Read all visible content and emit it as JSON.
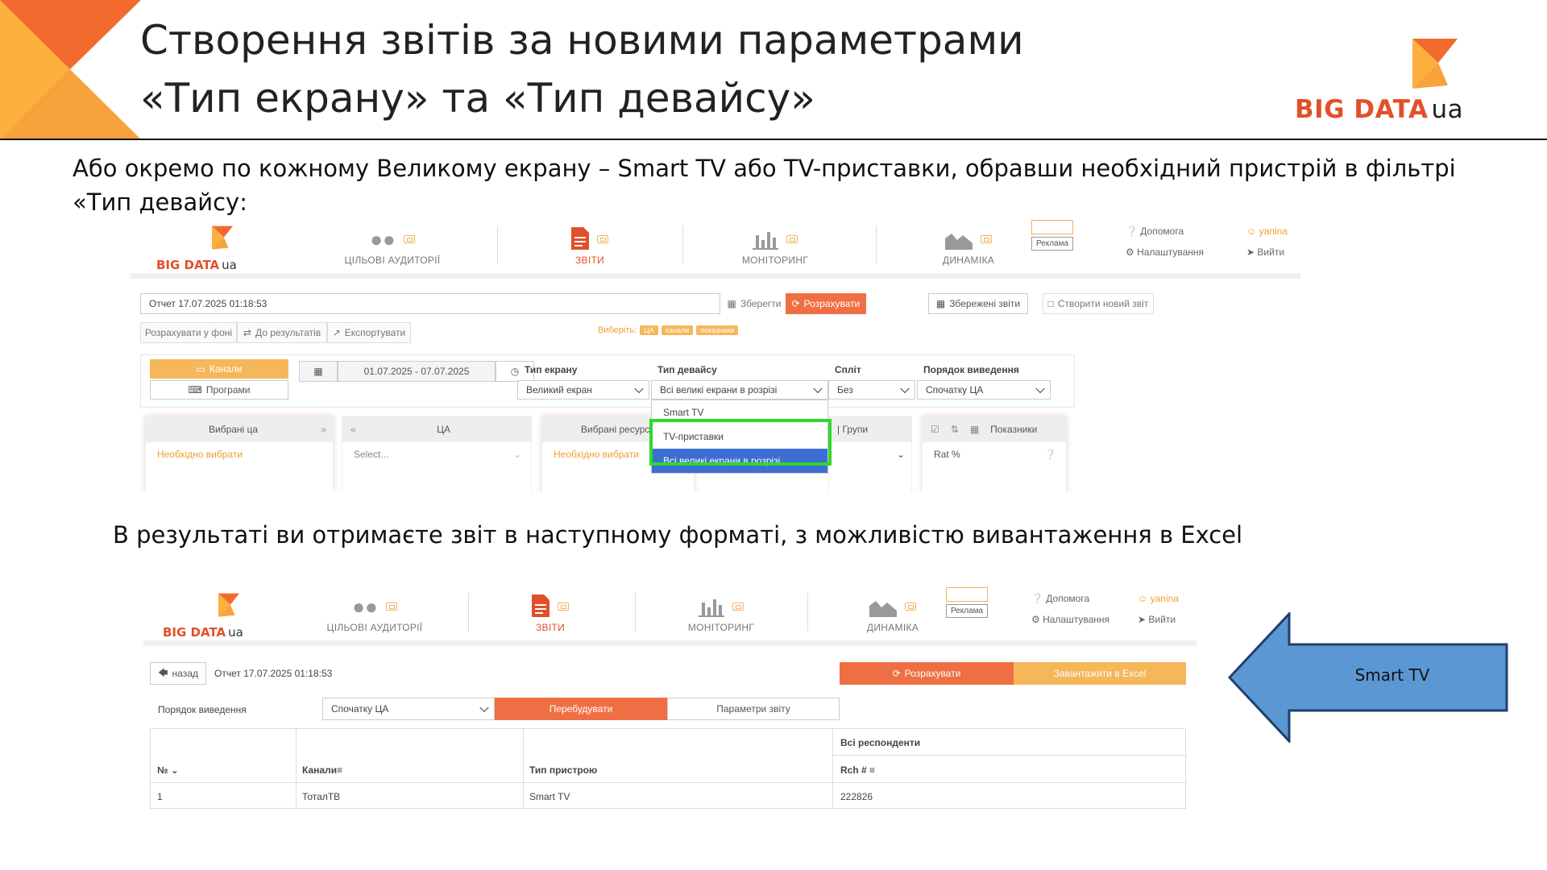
{
  "slide": {
    "title_line1": "Створення звітів за новими параметрами",
    "title_line2": "«Тип екрану» та «Тип девайсу»",
    "logo_text": "BIG DATA",
    "logo_suffix": "ua",
    "intro": "Або окремо по кожному Великому екрану – Smart TV або TV-приставки, обравши необхідний пристрій в фільтрі «Тип девайсу:",
    "result_text": "В результаті ви отримаєте звіт в наступному форматі, з можливістю вивантаження в Excel",
    "arrow_label": "Smart TV",
    "colors": {
      "orange": "#e2502a",
      "light_orange": "#f5a640",
      "arrow_blue": "#5b97d3",
      "arrow_border": "#1f3f6e",
      "highlight_green": "#33d62e"
    }
  },
  "app": {
    "logo_text": "BIG DATA",
    "logo_suffix": "ua",
    "nav": [
      {
        "label": "ЦІЛЬОВІ АУДИТОРІЇ",
        "icon": "audience-icon"
      },
      {
        "label": "ЗВІТИ",
        "icon": "report-icon"
      },
      {
        "label": "МОНІТОРИНГ",
        "icon": "bar-chart-icon"
      },
      {
        "label": "ДИНАМІКА",
        "icon": "area-chart-icon"
      }
    ],
    "ad_label": "Реклама",
    "help": "Допомога",
    "settings": "Налаштування",
    "user": "yanina",
    "logout": "Вийти"
  },
  "report_builder": {
    "report_name": "Отчет 17.07.2025 01:18:53",
    "save": "Зберегти",
    "calculate": "Розрахувати",
    "saved_reports": "Збережені звіти",
    "new_report": "Створити новий звіт",
    "calc_background": "Розрахувати у фоні",
    "to_results": "До результатів",
    "export": "Експортувати",
    "choose_label": "Виберіть:",
    "choose_chips": [
      "ЦА",
      "канали",
      "показники"
    ],
    "channels_tab": "Канали",
    "programs_tab": "Програми",
    "date_range": "01.07.2025 - 07.07.2025",
    "filters": [
      {
        "label": "Тип екрану",
        "value": "Великий екран"
      },
      {
        "label": "Тип девайсу",
        "value": "Всі великі екрани в розрізі"
      },
      {
        "label": "Спліт",
        "value": "Без"
      },
      {
        "label": "Порядок виведення",
        "value": "Спочатку ЦА"
      }
    ],
    "device_dropdown_options": [
      "Smart TV",
      "TV-приставки",
      "Всі великі екрани в розрізі"
    ],
    "panels": {
      "selected_ta": "Вибрані ца",
      "ta": "ЦА",
      "selected_resources": "Вибрані ресурси",
      "groups": "| Групи",
      "metrics": "Показники",
      "need_choose": "Необхідно вибрати",
      "select_placeholder": "Select...",
      "metric_value": "Rat %"
    }
  },
  "report_result": {
    "back": "назад",
    "report_name": "Отчет 17.07.2025 01:18:53",
    "calculate": "Розрахувати",
    "download_excel": "Завантажити в Excel",
    "order_label": "Порядок виведення",
    "order_value": "Спочатку ЦА",
    "rebuild": "Перебудувати",
    "report_params": "Параметри звіту",
    "group_header": "Всі респонденти",
    "columns": [
      "№",
      "Канали",
      "Тип пристрою",
      "Rch #"
    ],
    "rows": [
      [
        "1",
        "ТоталТВ",
        "Smart TV",
        "222826"
      ]
    ]
  }
}
